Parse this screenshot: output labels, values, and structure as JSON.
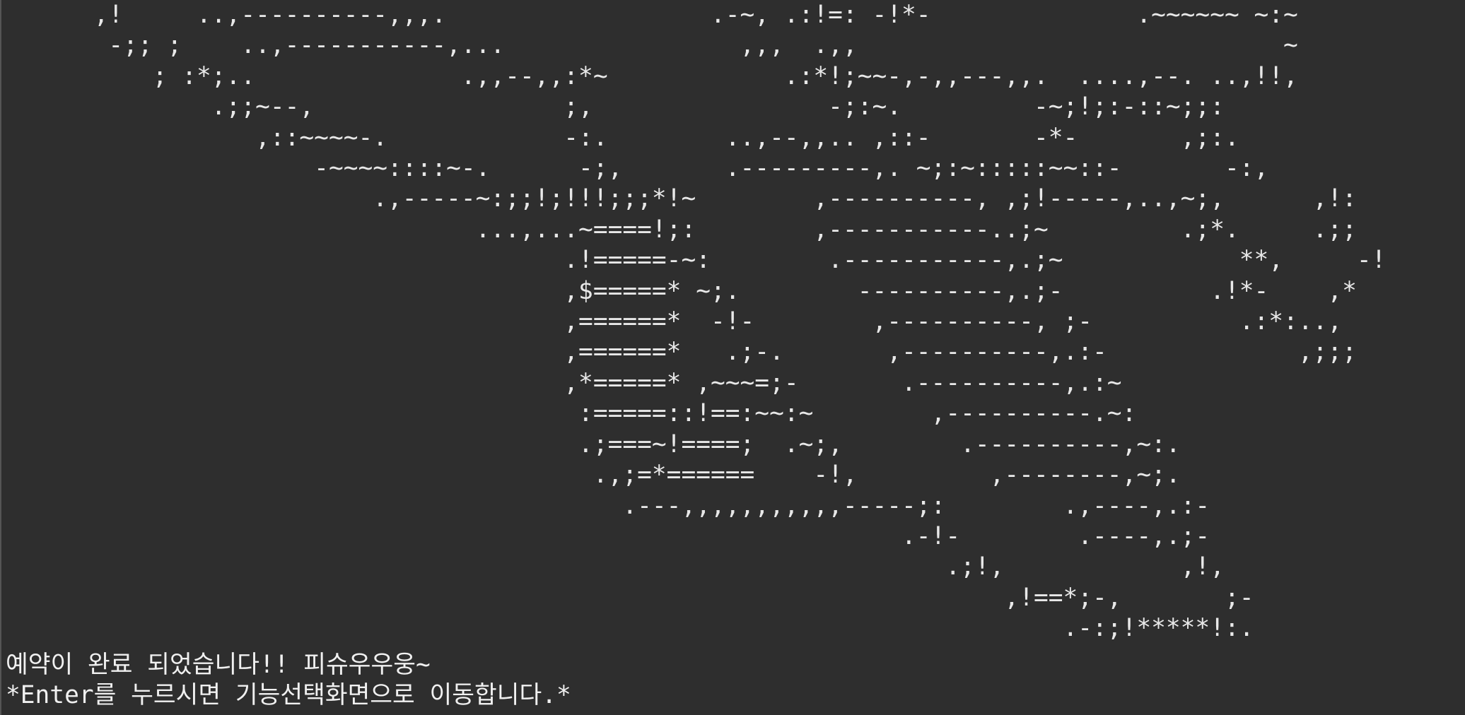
{
  "terminal": {
    "background": "#2e2e2e",
    "foreground": "#e8e8e8",
    "art_lines": [
      "      ,!     ..,----------,,,.                  .-~, .:!=: -!*-              .~~~~~~ ~:~",
      "       -;; ;    ..,-----------,...                ,,,  .,,                             ~",
      "          ; :*;..              .,,--,,:*~            .:*!;~~-,-,,---,,.  ....,--. ..,!!,",
      "              .;;~--,                 ;,                -;:~.         -~;!;:-::~;;:",
      "                 ,::~~~~-.            -:.        ..,--,,.. ,::-       -*-       ,;:.",
      "                     -~~~~::::~-.      -;,       .---------,. ~;:~:::::~~::-       -:,",
      "                         .,-----~:;;!;!!!;;;*!~        ,----------, ,;!-----,..,~;,      ,!:",
      "                                ...,...~====!;:        ,-----------..;~         .;*.     .;;",
      "                                      .!=====-~:        .-----------,.;~            **,     -!",
      "                                      ,$=====* ~;.        ----------,.;-          .!*-    ,*",
      "                                      ,======*  -!-        ,----------, ;-          .:*:..,",
      "                                      ,======*   .;-.       ,----------,.:-             ,;;;",
      "                                      ,*=====* ,~~~=;-       .----------,.:~",
      "                                       :=====::!==:~~:~        ,----------.~:",
      "                                       .;===~!====;  .~;,        .----------,~:.",
      "                                        .,;=*======    -!,         ,--------,~;.",
      "                                          .---,,,,,,,,,,,-----;:        .,----,.:-",
      "                                                             .-!-        .----,.;-",
      "                                                                .;!,            ,!,",
      "                                                                    ,!==*;-,       ;-",
      "                                                                        .-:;!*****!:."
    ],
    "message_line_1": "예약이 완료 되었습니다!! 피슈우우웅~",
    "message_line_2": "*Enter를 누르시면 기능선택화면으로 이동합니다.*"
  }
}
